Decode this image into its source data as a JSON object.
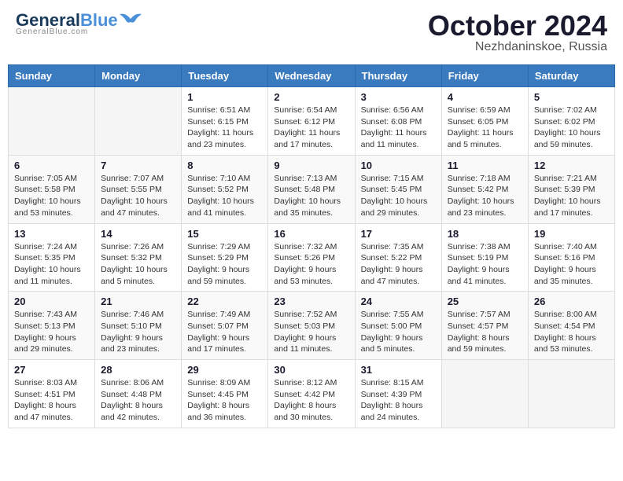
{
  "header": {
    "logo_general": "General",
    "logo_blue": "Blue",
    "month": "October 2024",
    "location": "Nezhdaninskoe, Russia"
  },
  "weekdays": [
    "Sunday",
    "Monday",
    "Tuesday",
    "Wednesday",
    "Thursday",
    "Friday",
    "Saturday"
  ],
  "weeks": [
    [
      {
        "day": "",
        "info": ""
      },
      {
        "day": "",
        "info": ""
      },
      {
        "day": "1",
        "info": "Sunrise: 6:51 AM\nSunset: 6:15 PM\nDaylight: 11 hours and 23 minutes."
      },
      {
        "day": "2",
        "info": "Sunrise: 6:54 AM\nSunset: 6:12 PM\nDaylight: 11 hours and 17 minutes."
      },
      {
        "day": "3",
        "info": "Sunrise: 6:56 AM\nSunset: 6:08 PM\nDaylight: 11 hours and 11 minutes."
      },
      {
        "day": "4",
        "info": "Sunrise: 6:59 AM\nSunset: 6:05 PM\nDaylight: 11 hours and 5 minutes."
      },
      {
        "day": "5",
        "info": "Sunrise: 7:02 AM\nSunset: 6:02 PM\nDaylight: 10 hours and 59 minutes."
      }
    ],
    [
      {
        "day": "6",
        "info": "Sunrise: 7:05 AM\nSunset: 5:58 PM\nDaylight: 10 hours and 53 minutes."
      },
      {
        "day": "7",
        "info": "Sunrise: 7:07 AM\nSunset: 5:55 PM\nDaylight: 10 hours and 47 minutes."
      },
      {
        "day": "8",
        "info": "Sunrise: 7:10 AM\nSunset: 5:52 PM\nDaylight: 10 hours and 41 minutes."
      },
      {
        "day": "9",
        "info": "Sunrise: 7:13 AM\nSunset: 5:48 PM\nDaylight: 10 hours and 35 minutes."
      },
      {
        "day": "10",
        "info": "Sunrise: 7:15 AM\nSunset: 5:45 PM\nDaylight: 10 hours and 29 minutes."
      },
      {
        "day": "11",
        "info": "Sunrise: 7:18 AM\nSunset: 5:42 PM\nDaylight: 10 hours and 23 minutes."
      },
      {
        "day": "12",
        "info": "Sunrise: 7:21 AM\nSunset: 5:39 PM\nDaylight: 10 hours and 17 minutes."
      }
    ],
    [
      {
        "day": "13",
        "info": "Sunrise: 7:24 AM\nSunset: 5:35 PM\nDaylight: 10 hours and 11 minutes."
      },
      {
        "day": "14",
        "info": "Sunrise: 7:26 AM\nSunset: 5:32 PM\nDaylight: 10 hours and 5 minutes."
      },
      {
        "day": "15",
        "info": "Sunrise: 7:29 AM\nSunset: 5:29 PM\nDaylight: 9 hours and 59 minutes."
      },
      {
        "day": "16",
        "info": "Sunrise: 7:32 AM\nSunset: 5:26 PM\nDaylight: 9 hours and 53 minutes."
      },
      {
        "day": "17",
        "info": "Sunrise: 7:35 AM\nSunset: 5:22 PM\nDaylight: 9 hours and 47 minutes."
      },
      {
        "day": "18",
        "info": "Sunrise: 7:38 AM\nSunset: 5:19 PM\nDaylight: 9 hours and 41 minutes."
      },
      {
        "day": "19",
        "info": "Sunrise: 7:40 AM\nSunset: 5:16 PM\nDaylight: 9 hours and 35 minutes."
      }
    ],
    [
      {
        "day": "20",
        "info": "Sunrise: 7:43 AM\nSunset: 5:13 PM\nDaylight: 9 hours and 29 minutes."
      },
      {
        "day": "21",
        "info": "Sunrise: 7:46 AM\nSunset: 5:10 PM\nDaylight: 9 hours and 23 minutes."
      },
      {
        "day": "22",
        "info": "Sunrise: 7:49 AM\nSunset: 5:07 PM\nDaylight: 9 hours and 17 minutes."
      },
      {
        "day": "23",
        "info": "Sunrise: 7:52 AM\nSunset: 5:03 PM\nDaylight: 9 hours and 11 minutes."
      },
      {
        "day": "24",
        "info": "Sunrise: 7:55 AM\nSunset: 5:00 PM\nDaylight: 9 hours and 5 minutes."
      },
      {
        "day": "25",
        "info": "Sunrise: 7:57 AM\nSunset: 4:57 PM\nDaylight: 8 hours and 59 minutes."
      },
      {
        "day": "26",
        "info": "Sunrise: 8:00 AM\nSunset: 4:54 PM\nDaylight: 8 hours and 53 minutes."
      }
    ],
    [
      {
        "day": "27",
        "info": "Sunrise: 8:03 AM\nSunset: 4:51 PM\nDaylight: 8 hours and 47 minutes."
      },
      {
        "day": "28",
        "info": "Sunrise: 8:06 AM\nSunset: 4:48 PM\nDaylight: 8 hours and 42 minutes."
      },
      {
        "day": "29",
        "info": "Sunrise: 8:09 AM\nSunset: 4:45 PM\nDaylight: 8 hours and 36 minutes."
      },
      {
        "day": "30",
        "info": "Sunrise: 8:12 AM\nSunset: 4:42 PM\nDaylight: 8 hours and 30 minutes."
      },
      {
        "day": "31",
        "info": "Sunrise: 8:15 AM\nSunset: 4:39 PM\nDaylight: 8 hours and 24 minutes."
      },
      {
        "day": "",
        "info": ""
      },
      {
        "day": "",
        "info": ""
      }
    ]
  ]
}
